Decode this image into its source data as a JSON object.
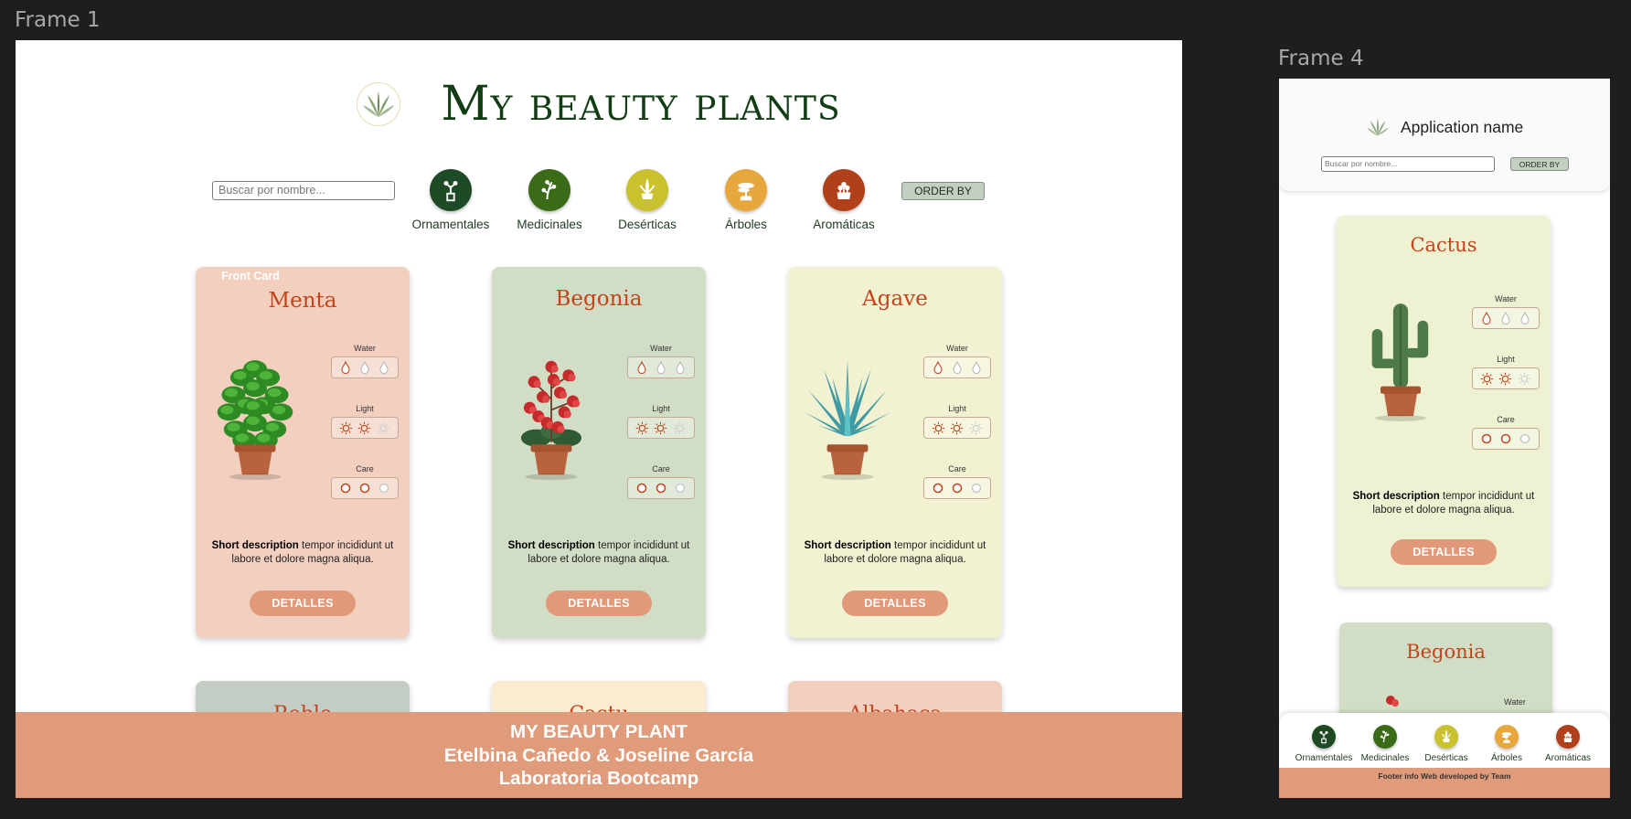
{
  "frames": {
    "frame1_label": "Frame 1",
    "frame4_label": "Frame 4"
  },
  "site": {
    "title": "My beauty plants",
    "search_placeholder": "Buscar por nombre...",
    "order_label": "ORDER BY"
  },
  "categories": [
    {
      "label": "Ornamentales",
      "color": "#1f4a26",
      "icon": "ornamental-icon"
    },
    {
      "label": "Medicinales",
      "color": "#3c6b18",
      "icon": "medicinal-icon"
    },
    {
      "label": "Desérticas",
      "color": "#c9c22e",
      "icon": "desert-icon"
    },
    {
      "label": "Árboles",
      "color": "#e7a73c",
      "icon": "tree-icon"
    },
    {
      "label": "Aromáticas",
      "color": "#b0401a",
      "icon": "aromatic-icon"
    }
  ],
  "cards": [
    {
      "name": "Menta",
      "bg": "#f2cfbf",
      "front_label": "Front Card",
      "plant": "mint-plant",
      "water": 1,
      "light": 2,
      "care": 2
    },
    {
      "name": "Begonia",
      "bg": "#d2ddc5",
      "plant": "begonia-plant",
      "water": 1,
      "light": 2,
      "care": 2
    },
    {
      "name": "Agave",
      "bg": "#f2f2d2",
      "plant": "agave-plant",
      "water": 1,
      "light": 2,
      "care": 2
    }
  ],
  "cut_cards": [
    {
      "name": "Roble",
      "bg": "#c4cdc4"
    },
    {
      "name": "Cactu",
      "bg": "#fbebd1"
    },
    {
      "name": "Albahaca",
      "bg": "#f2cfbf"
    }
  ],
  "attr_labels": {
    "water": "Water",
    "light": "Light",
    "care": "Care"
  },
  "desc": {
    "bold": "Short description",
    "text": " tempor incididunt ut labore et dolore magna aliqua."
  },
  "button_label": "DETALLES",
  "footer": {
    "line1": "MY BEAUTY PLANT",
    "line2": "Etelbina Cañedo & Joseline García",
    "line3": "Laboratoria Bootcamp"
  },
  "mobile": {
    "app_name": "Application name",
    "search_placeholder": "Buscar por nombre...",
    "order_label": "ORDER BY",
    "card1": {
      "name": "Cactus",
      "bg": "#eff1d3",
      "plant": "cactus-plant",
      "water": 1,
      "light": 2,
      "care": 2
    },
    "card2": {
      "name": "Begonia",
      "bg": "#d2ddc5",
      "water_label": "Water"
    },
    "footer": "Footer info Web developed by Team"
  },
  "colors": {
    "accent": "#e1997a",
    "title": "#123d14",
    "card_name": "#c2441a"
  }
}
